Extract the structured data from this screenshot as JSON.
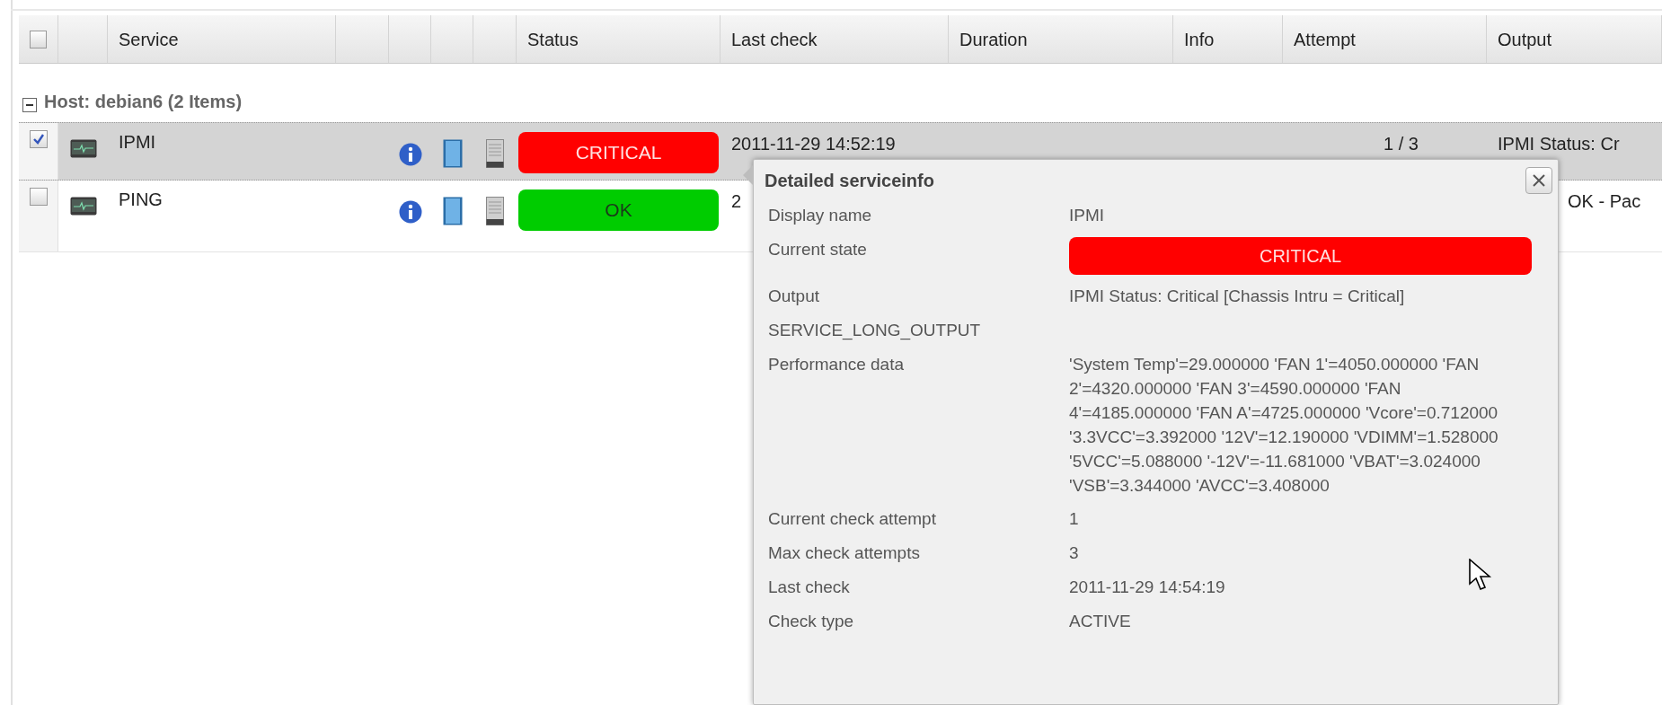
{
  "table": {
    "header_checkbox": {
      "checked": false
    },
    "columns": [
      "Service",
      "Status",
      "Last check",
      "Duration",
      "Info",
      "Attempt",
      "Output"
    ],
    "group": {
      "label": "Host: debian6 (2 Items)",
      "expanded": true
    },
    "rows": [
      {
        "checked": true,
        "selected": true,
        "service": "IPMI",
        "kind": "critical",
        "status": "CRITICAL",
        "last_check": "2011-11-29 14:52:19",
        "attempt": "1 / 3",
        "output": "IPMI Status: Cr"
      },
      {
        "checked": false,
        "selected": false,
        "service": "PING",
        "kind": "ok",
        "status": "OK",
        "last_check": "2",
        "output": "OK - Pac"
      }
    ]
  },
  "popup": {
    "title": "Detailed serviceinfo",
    "fields": [
      {
        "label": "Display name",
        "value": "IPMI"
      },
      {
        "label": "Current state",
        "value": "CRITICAL",
        "kind": "critical"
      },
      {
        "label": "Output",
        "value": "IPMI Status: Critical [Chassis Intru = Critical]"
      },
      {
        "label": "SERVICE_LONG_OUTPUT"
      },
      {
        "label": "Performance data",
        "value": "'System Temp'=29.000000 'FAN 1'=4050.000000 'FAN 2'=4320.000000 'FAN 3'=4590.000000 'FAN 4'=4185.000000 'FAN A'=4725.000000 'Vcore'=0.712000 '3.3VCC'=3.392000 '12V'=12.190000 'VDIMM'=1.528000 '5VCC'=5.088000 '-12V'=-11.681000 'VBAT'=3.024000 'VSB'=3.344000 'AVCC'=3.408000"
      },
      {
        "label": "Current check attempt",
        "value": "1"
      },
      {
        "label": "Max check attempts",
        "value": "3"
      },
      {
        "label": "Last check",
        "value": "2011-11-29 14:54:19"
      },
      {
        "label": "Check type",
        "value": "ACTIVE"
      }
    ]
  }
}
